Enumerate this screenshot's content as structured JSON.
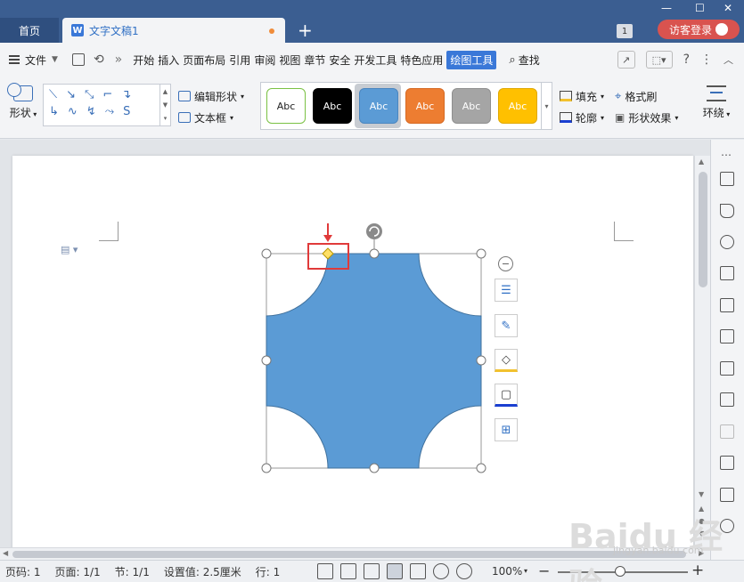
{
  "tabs": {
    "home": "首页",
    "doc_title": "文字文稿1",
    "new_tab": "+",
    "doc_logo": "W"
  },
  "window": {
    "page_count_badge": "1",
    "login_label": "访客登录"
  },
  "menu": {
    "file_label": "文件",
    "more": "»",
    "items": [
      "开始",
      "插入",
      "页面布局",
      "引用",
      "审阅",
      "视图",
      "章节",
      "安全",
      "开发工具",
      "特色应用"
    ],
    "active_item": "绘图工具",
    "search_label": "查找"
  },
  "ribbon": {
    "shape_label": "形状",
    "edit_shape_label": "编辑形状",
    "text_box_label": "文本框",
    "style_samples": [
      {
        "label": "Abc",
        "bg": "#ffffff",
        "fg": "#222222",
        "border": "#7ac143"
      },
      {
        "label": "Abc",
        "bg": "#000000",
        "fg": "#ffffff",
        "border": "#000000"
      },
      {
        "label": "Abc",
        "bg": "#5b9bd5",
        "fg": "#ffffff",
        "border": "#4a86c0"
      },
      {
        "label": "Abc",
        "bg": "#ed7d31",
        "fg": "#ffffff",
        "border": "#d66a24"
      },
      {
        "label": "Abc",
        "bg": "#a5a5a5",
        "fg": "#ffffff",
        "border": "#8f8f8f"
      },
      {
        "label": "Abc",
        "bg": "#ffc000",
        "fg": "#ffffff",
        "border": "#e0a800"
      }
    ],
    "fill_label": "填充",
    "format_painter_label": "格式刷",
    "outline_label": "轮廓",
    "shape_effect_label": "形状效果",
    "wrap_label": "环绕"
  },
  "shape": {
    "fill_color": "#5b9bd5",
    "stroke_color": "#41719c",
    "handle_highlight_color": "#e03a3a"
  },
  "status": {
    "page_num": "页码: 1",
    "page": "页面: 1/1",
    "section": "节: 1/1",
    "setting": "设置值: 2.5厘米",
    "row": "行: 1",
    "zoom": "100%"
  },
  "watermark": {
    "logo": "Baidu 经验",
    "url": "jingyan.baidu.com"
  }
}
